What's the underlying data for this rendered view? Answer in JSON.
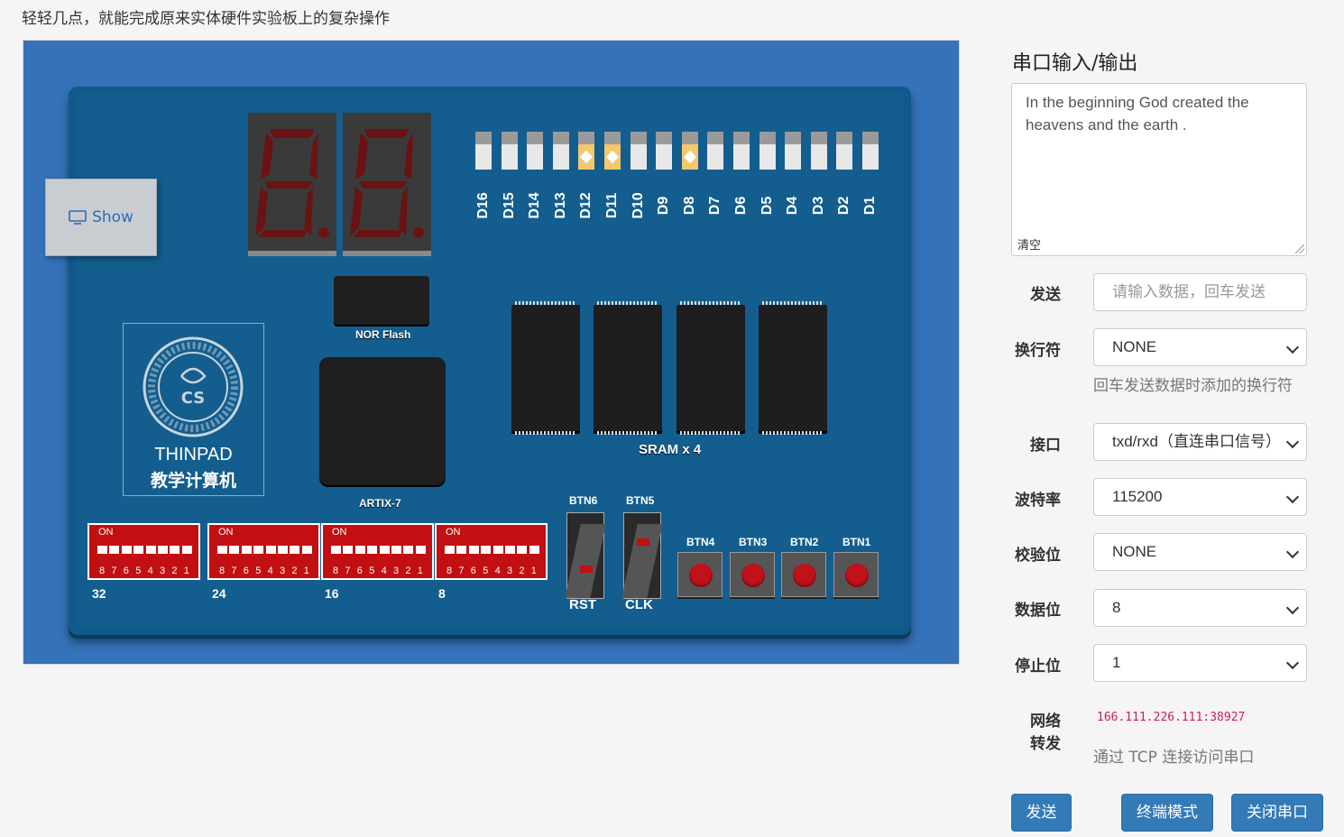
{
  "tagline": "轻轻几点，就能完成原来实体硬件实验板上的复杂操作",
  "board": {
    "show_label": "Show",
    "nor_flash_label": "NOR Flash",
    "fpga_label": "ARTIX-7",
    "sram_label": "SRAM x 4",
    "logo_title": "THINPAD",
    "logo_subtitle": "教学计算机",
    "leds": [
      {
        "label": "D16",
        "on": false
      },
      {
        "label": "D15",
        "on": false
      },
      {
        "label": "D14",
        "on": false
      },
      {
        "label": "D13",
        "on": false
      },
      {
        "label": "D12",
        "on": true
      },
      {
        "label": "D11",
        "on": true
      },
      {
        "label": "D10",
        "on": false
      },
      {
        "label": "D9",
        "on": false
      },
      {
        "label": "D8",
        "on": true
      },
      {
        "label": "D7",
        "on": false
      },
      {
        "label": "D6",
        "on": false
      },
      {
        "label": "D5",
        "on": false
      },
      {
        "label": "D4",
        "on": false
      },
      {
        "label": "D3",
        "on": false
      },
      {
        "label": "D2",
        "on": false
      },
      {
        "label": "D1",
        "on": false
      }
    ],
    "dip_on_label": "ON",
    "dip_numbers": [
      "8",
      "7",
      "6",
      "5",
      "4",
      "3",
      "2",
      "1"
    ],
    "dip_groups": [
      "32",
      "24",
      "16",
      "8"
    ],
    "toggle_buttons": [
      {
        "top_label": "BTN6",
        "bottom_label": "RST"
      },
      {
        "top_label": "BTN5",
        "bottom_label": "CLK"
      }
    ],
    "push_buttons": [
      "BTN4",
      "BTN3",
      "BTN2",
      "BTN1"
    ]
  },
  "serial": {
    "title": "串口输入/输出",
    "output_text": "In the beginning God created the heavens and the earth .",
    "clear_label": "清空",
    "send_label": "发送",
    "send_placeholder": "请输入数据，回车发送",
    "newline_label": "换行符",
    "newline_value": "NONE",
    "newline_help": "回车发送数据时添加的换行符",
    "port_label": "接口",
    "port_value": "txd/rxd（直连串口信号）",
    "baud_label": "波特率",
    "baud_value": "115200",
    "parity_label": "校验位",
    "parity_value": "NONE",
    "databits_label": "数据位",
    "databits_value": "8",
    "stopbits_label": "停止位",
    "stopbits_value": "1",
    "forward_label_1": "网络",
    "forward_label_2": "转发",
    "forward_address": "166.111.226.111:38927",
    "forward_help": "通过 TCP 连接访问串口",
    "btn_send": "发送",
    "btn_terminal": "终端模式",
    "btn_close": "关闭串口"
  }
}
